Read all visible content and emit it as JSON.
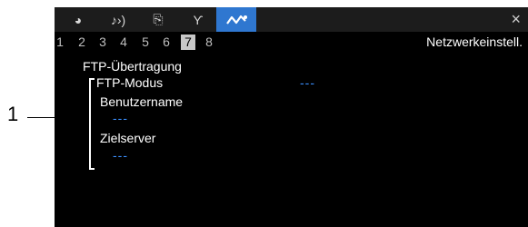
{
  "annotation": {
    "callout_number": "1"
  },
  "tabs": [
    {
      "icon": "camera-icon",
      "glyph": "◕"
    },
    {
      "icon": "audio-icon",
      "glyph": "♪›)"
    },
    {
      "icon": "custom-settings-icon",
      "glyph": "⎘"
    },
    {
      "icon": "tools-icon",
      "glyph": "Ƴ"
    },
    {
      "icon": "network-icon",
      "glyph": "〰",
      "active": true
    }
  ],
  "close_label": "×",
  "pages": [
    "1",
    "2",
    "3",
    "4",
    "5",
    "6",
    "7",
    "8"
  ],
  "active_page": "7",
  "page_title": "Netzwerkeinstell.",
  "section_title": "FTP-Übertragung",
  "items": {
    "ftp_mode": {
      "label": "FTP-Modus",
      "value": "---"
    },
    "username": {
      "label": "Benutzername",
      "value": "---"
    },
    "target_server": {
      "label": "Zielserver",
      "value": "---"
    }
  },
  "colors": {
    "active_tab": "#2f77d0",
    "value_text": "#3a8fff",
    "screen_bg": "#000000"
  }
}
